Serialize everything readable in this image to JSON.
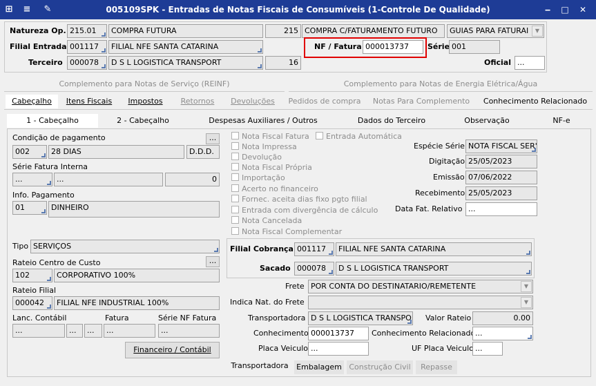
{
  "window": {
    "title": "005109SPK - Entradas de Notas Fiscais de Consumíveis (1-Controle De Qualidade)",
    "icons": [
      "menu-icon",
      "tree-icon",
      "wrench-icon"
    ],
    "controls": {
      "minimize": "‒",
      "maximize": "□",
      "close": "✕"
    }
  },
  "header": {
    "natureza_label": "Natureza Op.",
    "natureza_code": "215.01",
    "natureza_desc": "COMPRA FUTURA",
    "natureza_num": "215",
    "natureza_desc2": "COMPRA C/FATURAMENTO FUTURO",
    "guias": "GUIAS PARA FATURAI",
    "filial_label": "Filial Entrada",
    "filial_code": "001117",
    "filial_desc": "FILIAL NFE SANTA CATARINA",
    "nf_label": "NF / Fatura",
    "nf_value": "000013737",
    "serie_label": "Série",
    "serie_value": "001",
    "terceiro_label": "Terceiro",
    "terceiro_code": "000078",
    "terceiro_desc": "D S L LOGISTICA TRANSPORT",
    "terceiro_num": "16",
    "oficial_label": "Oficial",
    "oficial_value": "..."
  },
  "tabs_top": [
    "Complemento para Notas de Serviço (REINF)",
    "Complemento para Notas de Energia Elétrica/Água"
  ],
  "tabs_main": [
    "Cabeçalho",
    "Itens Fiscais",
    "Impostos",
    "Retornos",
    "Devoluções",
    "Pedidos de compra",
    "Notas Para Complemento",
    "Conhecimento Relacionado"
  ],
  "tabs_sub": [
    "1 - Cabeçalho",
    "2 - Cabeçalho",
    "Despesas Auxiliares / Outros",
    "Dados do Terceiro",
    "Observação",
    "NF-e"
  ],
  "left": {
    "cond_label": "Condição de pagamento",
    "cond_code": "002",
    "cond_desc": "28 DIAS",
    "cond_type": "D.D.D.",
    "ellipsis": "...",
    "serie_label": "Série Fatura Interna",
    "serie_a": "...",
    "serie_b": "...",
    "serie_num": "0",
    "info_label": "Info. Pagamento",
    "info_code": "01",
    "info_desc": "DINHEIRO",
    "tipo_label": "Tipo",
    "tipo_value": "SERVIÇOS",
    "rateio_label": "Rateio Centro de Custo",
    "rateio_code": "102",
    "rateio_desc": "CORPORATIVO 100%",
    "rateiof_label": "Rateio Filial",
    "rateiof_code": "000042",
    "rateiof_desc": "FILIAL NFE INDUSTRIAL 100%",
    "lanc_label": "Lanc. Contábil",
    "fatura_label": "Fatura",
    "serienf_label": "Série NF Fatura",
    "f1": "...",
    "f2": "...",
    "f3": "...",
    "f4": "...",
    "f5": "...",
    "fin_button": "Financeiro / Contábil"
  },
  "checks": [
    "Nota Fiscal Fatura",
    "Nota Impressa",
    "Devolução",
    "Nota Fiscal Própria",
    "Importação",
    "Acerto no financeiro",
    "Fornec. aceita dias fixo pgto filial",
    "Entrada com divergência de cálculo",
    "Nota Cancelada",
    "Nota Fiscal Complementar"
  ],
  "check_auto": "Entrada Automática",
  "right": {
    "especie_label": "Espécie Série",
    "especie_value": "NOTA FISCAL SER'",
    "digit_label": "Digitação",
    "digit_value": "25/05/2023",
    "emissao_label": "Emissão",
    "emissao_value": "07/06/2022",
    "receb_label": "Recebimento",
    "receb_value": "25/05/2023",
    "datafat_label": "Data Fat. Relativo",
    "datafat_value": "..."
  },
  "cobranca": {
    "filial_label": "Filial Cobrança",
    "filial_code": "001117",
    "filial_desc": "FILIAL NFE SANTA CATARINA",
    "sacado_label": "Sacado",
    "sacado_code": "000078",
    "sacado_desc": "D S L LOGISTICA TRANSPORT"
  },
  "frete": {
    "frete_label": "Frete",
    "frete_value": "POR CONTA DO DESTINATARIO/REMETENTE",
    "indica_label": "Indica Nat. do Frete",
    "indica_value": "",
    "transp_label": "Transportadora",
    "transp_value": "D S L LOGISTICA TRANSPOI",
    "valor_label": "Valor Rateio",
    "valor_value": "0.00",
    "conh_label": "Conhecimento",
    "conh_value": "000013737",
    "conhrel_label": "Conhecimento Relacionado",
    "conhrel_value": "...",
    "placa_label": "Placa Veiculo",
    "placa_value": "...",
    "ufplaca_label": "UF Placa Veiculo",
    "ufplaca_value": "..."
  },
  "tabs_bottom": [
    "Transportadora",
    "Embalagem",
    "Construção Civil",
    "Repasse"
  ],
  "colors": {
    "titlebar": "#1e3c96",
    "highlight": "#e00000"
  }
}
